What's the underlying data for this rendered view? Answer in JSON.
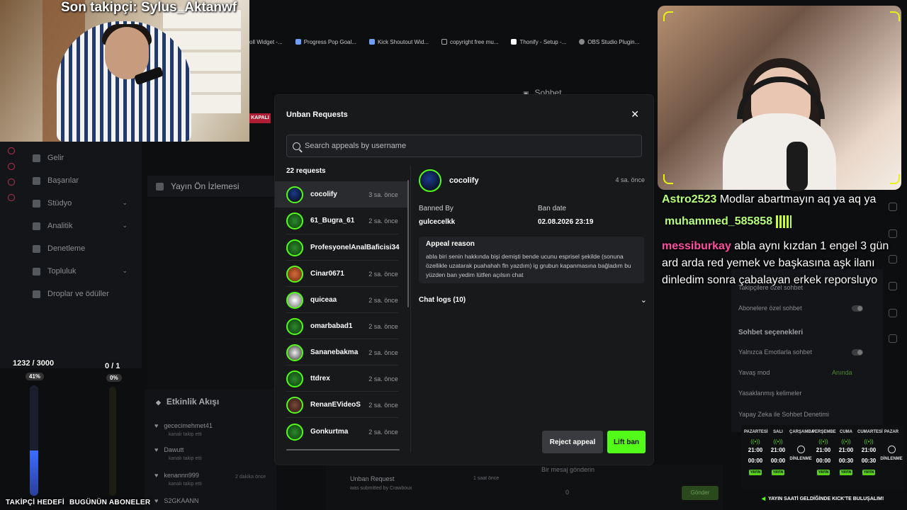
{
  "overlay": {
    "last_follower": "Son takipçi: Sylus_Aktanwf",
    "follower_goal_count": "1232 / 3000",
    "follower_goal_pct": "41%",
    "follower_goal_progress": 0.41,
    "sub_goal_count": "0 / 1",
    "sub_goal_pct": "0%",
    "follower_goal_label": "TAKİPÇİ HEDEFİ",
    "sub_goal_label": "BUGÜNÜN ABONELER",
    "kapali": "KAPALI"
  },
  "bookmarks": [
    "oll Widget -...",
    "Progress Pop Goal...",
    "Kick Shoutout Wid...",
    "copyright free mu...",
    "Thonify - Setup -...",
    "OBS Studio Plugin..."
  ],
  "sidebar": {
    "items": [
      {
        "label": "Gelir"
      },
      {
        "label": "Başarılar"
      },
      {
        "label": "Stüdyo"
      },
      {
        "label": "Analitik"
      },
      {
        "label": "Denetleme"
      },
      {
        "label": "Topluluk"
      },
      {
        "label": "Droplar ve ödüller"
      }
    ]
  },
  "dashboard": {
    "preview_title": "Yayın Ön İzlemesi",
    "activity_title": "Etkinlik Akışı",
    "chat_title": "Sohbet",
    "activity_items": [
      {
        "user": "gececimehmet41",
        "sub": "kanalı takip etti"
      },
      {
        "user": "Dawutt",
        "sub": "kanalı takip etti"
      },
      {
        "user": "kenannn999",
        "sub": "kanalı takip etti"
      },
      {
        "user": "S2GKAANN",
        "sub": ""
      }
    ],
    "unban_title": "Unban Request",
    "unban_sub": "was submitted by Crawboux",
    "unban_time": "1 saat önce",
    "activity_time": "2 dakika önce",
    "send_label": "Gönder",
    "chat_placeholder": "Bir mesaj gönderin",
    "viewer_count": "0"
  },
  "chat_overlay": [
    {
      "user": "Astro2523",
      "color": "#b6ff7a",
      "text": "Modlar abartmayın aq ya aq ya"
    },
    {
      "user": "muhammed_585858",
      "color": "#b6ff7a",
      "text": ""
    },
    {
      "user": "messiburkay",
      "color": "#ff4fa0",
      "text": "abla aynı kızdan 1 engel 3 gün ard arda red yemek ve başkasına aşk ilanı dinledim sonra çabalayan erkek reporsluyo"
    }
  ],
  "settings": {
    "rows": [
      "Takipçilere özel sohbet",
      "Abonelere özel sohbet",
      "Sohbet seçenekleri",
      "Yalnızca Emotlarla sohbet",
      "Yavaş mod",
      "Yasaklanmış kelimeler",
      "Yapay Zeka ile Sohbet Denetimi"
    ],
    "slow_mode_value": "Anında"
  },
  "schedule": {
    "days": [
      {
        "name": "PAZARTESİ",
        "start": "21:00",
        "end": "00:00",
        "tag": "YAYIN"
      },
      {
        "name": "SALI",
        "start": "21:00",
        "end": "00:00",
        "tag": "YAYIN"
      },
      {
        "name": "ÇARŞAMBA",
        "start": "",
        "end": "DİNLENME",
        "tag": ""
      },
      {
        "name": "PERŞEMBE",
        "start": "21:00",
        "end": "00:00",
        "tag": "YAYIN"
      },
      {
        "name": "CUMA",
        "start": "21:00",
        "end": "00:30",
        "tag": "YAYIN"
      },
      {
        "name": "CUMARTESİ",
        "start": "21:00",
        "end": "00:30",
        "tag": "YAYIN"
      },
      {
        "name": "PAZAR",
        "start": "",
        "end": "DİNLENME",
        "tag": ""
      }
    ],
    "footer": "YAYIN SAATİ GELDİĞİNDE KICK'TE BULUŞALIM!"
  },
  "modal": {
    "title": "Unban Requests",
    "search_placeholder": "Search appeals by username",
    "request_count": "22 requests",
    "requests": [
      {
        "name": "cocolify",
        "time": "3 sa. önce"
      },
      {
        "name": "61_Bugra_61",
        "time": "2 sa. önce"
      },
      {
        "name": "ProfesyonelAnalBaficisi34",
        "time": ""
      },
      {
        "name": "Cinar0671",
        "time": "2 sa. önce"
      },
      {
        "name": "quiceaa",
        "time": "2 sa. önce"
      },
      {
        "name": "omarbabad1",
        "time": "2 sa. önce"
      },
      {
        "name": "Sananebakma",
        "time": "2 sa. önce"
      },
      {
        "name": "ttdrex",
        "time": "2 sa. önce"
      },
      {
        "name": "RenanEVideoS",
        "time": "2 sa. önce"
      },
      {
        "name": "Gonkurtma",
        "time": "2 sa. önce"
      }
    ],
    "detail": {
      "name": "cocolify",
      "time": "4 sa. önce",
      "banned_by_label": "Banned By",
      "banned_by": "gulcecelkk",
      "ban_date_label": "Ban date",
      "ban_date": "02.08.2026 23:19",
      "reason_title": "Appeal reason",
      "reason_text": "abla biri senin hakkında bişi demişti bende ucunu esprisel şekilde (sonuna özellikle uzatarak puahahah fln yazdım) ig grubun kapanmasına bağladım bu yüzden ban yedim lütfen açılsın chat",
      "chat_logs": "Chat logs (10)"
    },
    "reject_label": "Reject appeal",
    "lift_label": "Lift ban"
  },
  "colors": {
    "kick_green": "#53fc18",
    "modal_bg": "#18191b"
  }
}
